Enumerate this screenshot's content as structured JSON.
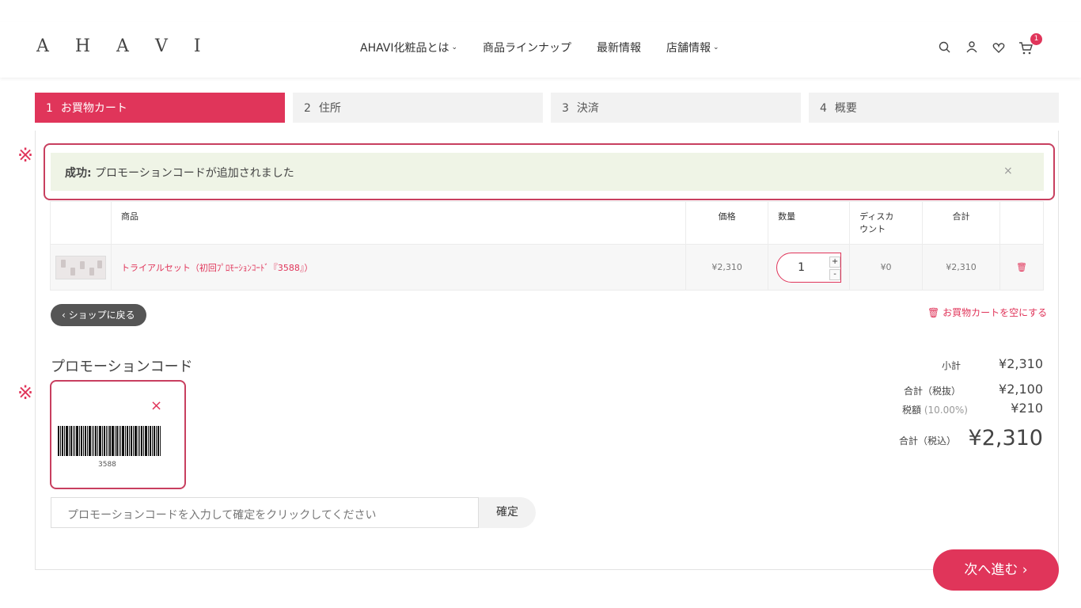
{
  "header": {
    "logo": "A H A V I",
    "nav": [
      {
        "label": "AHAVI化粧品とは",
        "dropdown": true
      },
      {
        "label": "商品ラインナップ",
        "dropdown": false
      },
      {
        "label": "最新情報",
        "dropdown": false
      },
      {
        "label": "店舗情報",
        "dropdown": true
      }
    ],
    "icons": [
      "search-icon",
      "user-icon",
      "heart-icon",
      "cart-icon"
    ],
    "cart_count": "1"
  },
  "steps": [
    {
      "num": "1",
      "label": "お買物カート",
      "active": true
    },
    {
      "num": "2",
      "label": "住所",
      "active": false
    },
    {
      "num": "3",
      "label": "決済",
      "active": false
    },
    {
      "num": "4",
      "label": "概要",
      "active": false
    }
  ],
  "annotation_mark": "※",
  "alert": {
    "label": "成功:",
    "message": " プロモーションコードが追加されました",
    "close": "×"
  },
  "table": {
    "headers": [
      "",
      "商品",
      "価格",
      "数量",
      "ディスカウント",
      "合計",
      ""
    ],
    "rows": [
      {
        "product": "トライアルセット（初回ﾌﾟﾛﾓｰｼｮﾝｺｰﾄﾞ『3588』）",
        "price": "¥2,310",
        "quantity": "1",
        "discount": "¥0",
        "total": "¥2,310"
      }
    ]
  },
  "back_button": "‹ ショップに戻る",
  "empty_cart": "お買物カートを空にする",
  "promo": {
    "title": "プロモーションコード",
    "coupon_code": "3588",
    "remove": "×",
    "input_placeholder": "プロモーションコードを入力して確定をクリックしてください",
    "confirm": "確定"
  },
  "summary": {
    "subtotal_label": "小計",
    "subtotal": "¥2,310",
    "total_excl_label": "合計（税抜）",
    "total_excl": "¥2,100",
    "tax_label": "税額",
    "tax_rate": "(10.00%)",
    "tax": "¥210",
    "total_incl_label": "合計（税込）",
    "total_incl": "¥2,310"
  },
  "next_button": "次へ進む ›",
  "colors": {
    "accent": "#e0355a",
    "alert_bg": "#eff4e6"
  }
}
